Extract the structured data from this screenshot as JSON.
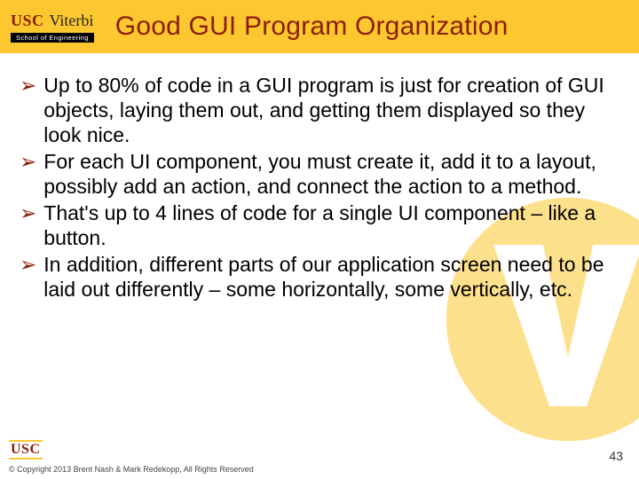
{
  "header": {
    "logo_usc": "USC",
    "logo_viterbi": "Viterbi",
    "logo_sub": "School of Engineering",
    "title": "Good GUI Program Organization"
  },
  "bullets": [
    "Up to 80% of code in a GUI program is just for creation of GUI objects, laying them out, and getting them displayed so they look nice.",
    "For each UI component, you must create it, add it to a layout, possibly add an action, and connect the action to a method.",
    "That's up to 4 lines of code for a single UI component – like a button.",
    "In addition, different parts of our application screen need to be laid out differently – some horizontally, some vertically, etc."
  ],
  "footer": {
    "mark": "USC",
    "copyright": "© Copyright 2013 Brent Nash & Mark Redekopp, All Rights Reserved",
    "page": "43"
  }
}
